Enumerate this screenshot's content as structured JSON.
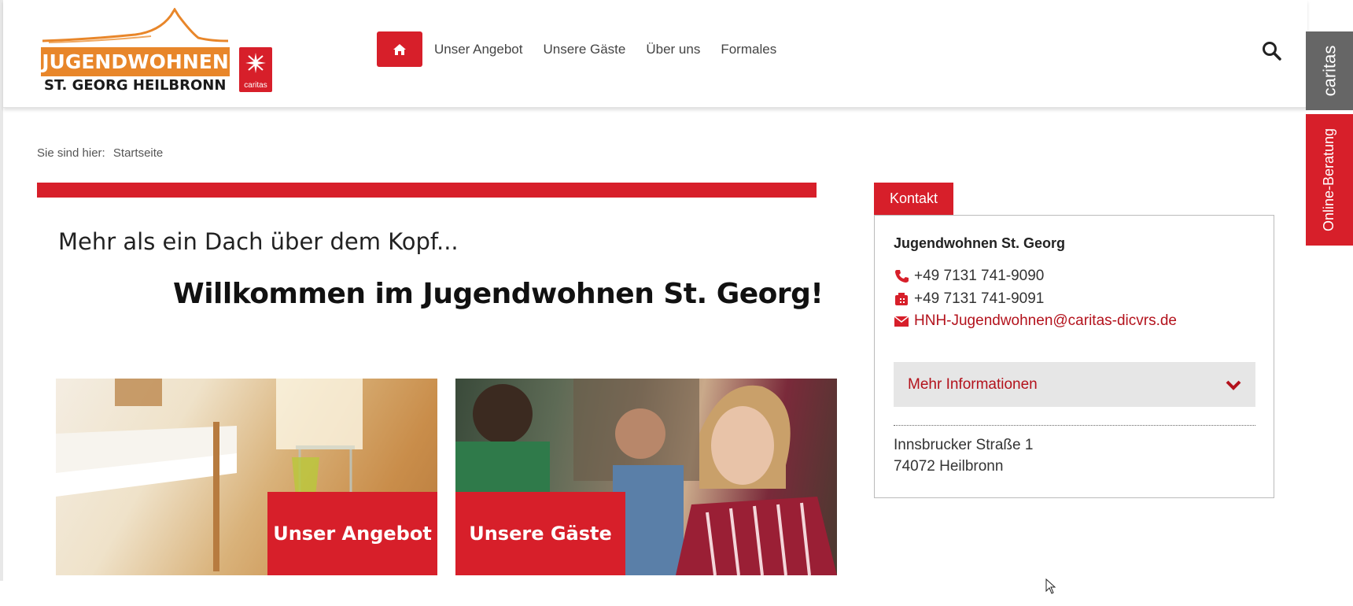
{
  "logo": {
    "brand": "JUGENDWOHNEN",
    "subtitle": "ST. GEORG HEILBRONN",
    "badge": "caritas"
  },
  "nav": {
    "home_icon": "home-icon",
    "items": [
      "Unser Angebot",
      "Unsere Gäste",
      "Über uns",
      "Formales"
    ]
  },
  "search": {
    "icon": "search-icon"
  },
  "side_tabs": {
    "caritas": "caritas",
    "online": "Online-Beratung"
  },
  "breadcrumb": {
    "prefix": "Sie sind hier:",
    "current": "Startseite"
  },
  "main": {
    "tagline": "Mehr als ein Dach über dem Kopf...",
    "welcome": "Willkommen im Jugendwohnen St. Georg!",
    "tiles": [
      {
        "label": "Unser Angebot"
      },
      {
        "label": "Unsere Gäste"
      }
    ]
  },
  "contact": {
    "tab": "Kontakt",
    "name": "Jugendwohnen St. Georg",
    "phone": "+49 7131 741-9090",
    "fax": "+49 7131 741-9091",
    "email": "HNH-Jugendwohnen@caritas-dicvrs.de",
    "more": "Mehr Informationen",
    "street": "Innsbrucker Straße 1",
    "city": "74072 Heilbronn"
  },
  "colors": {
    "accent": "#d71f2a",
    "orange": "#e8862a",
    "side_grey": "#666666"
  }
}
